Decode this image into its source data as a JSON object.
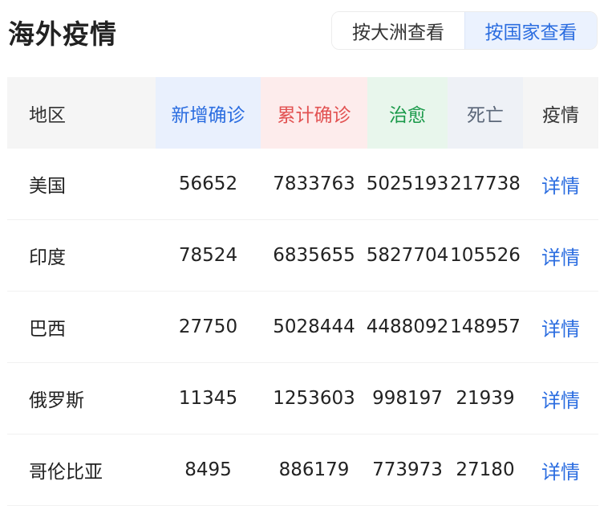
{
  "header": {
    "title": "海外疫情",
    "toggle": {
      "by_continent": "按大洲查看",
      "by_country": "按国家查看",
      "selected": "by_country"
    }
  },
  "colors": {
    "accent_blue": "#2b6de0",
    "new_confirmed": "#2b6de0",
    "total_confirmed": "#e25252",
    "cured": "#1a9a4a",
    "dead": "#5a6678"
  },
  "table": {
    "columns": {
      "region": "地区",
      "new_confirmed": "新增确诊",
      "total_confirmed": "累计确诊",
      "cured": "治愈",
      "dead": "死亡",
      "detail": "疫情"
    },
    "rows": [
      {
        "region": "美国",
        "new_confirmed": "56652",
        "total_confirmed": "7833763",
        "cured": "5025193",
        "dead": "217738",
        "detail": "详情"
      },
      {
        "region": "印度",
        "new_confirmed": "78524",
        "total_confirmed": "6835655",
        "cured": "5827704",
        "dead": "105526",
        "detail": "详情"
      },
      {
        "region": "巴西",
        "new_confirmed": "27750",
        "total_confirmed": "5028444",
        "cured": "4488092",
        "dead": "148957",
        "detail": "详情"
      },
      {
        "region": "俄罗斯",
        "new_confirmed": "11345",
        "total_confirmed": "1253603",
        "cured": "998197",
        "dead": "21939",
        "detail": "详情"
      },
      {
        "region": "哥伦比亚",
        "new_confirmed": "8495",
        "total_confirmed": "886179",
        "cured": "773973",
        "dead": "27180",
        "detail": "详情"
      }
    ]
  }
}
